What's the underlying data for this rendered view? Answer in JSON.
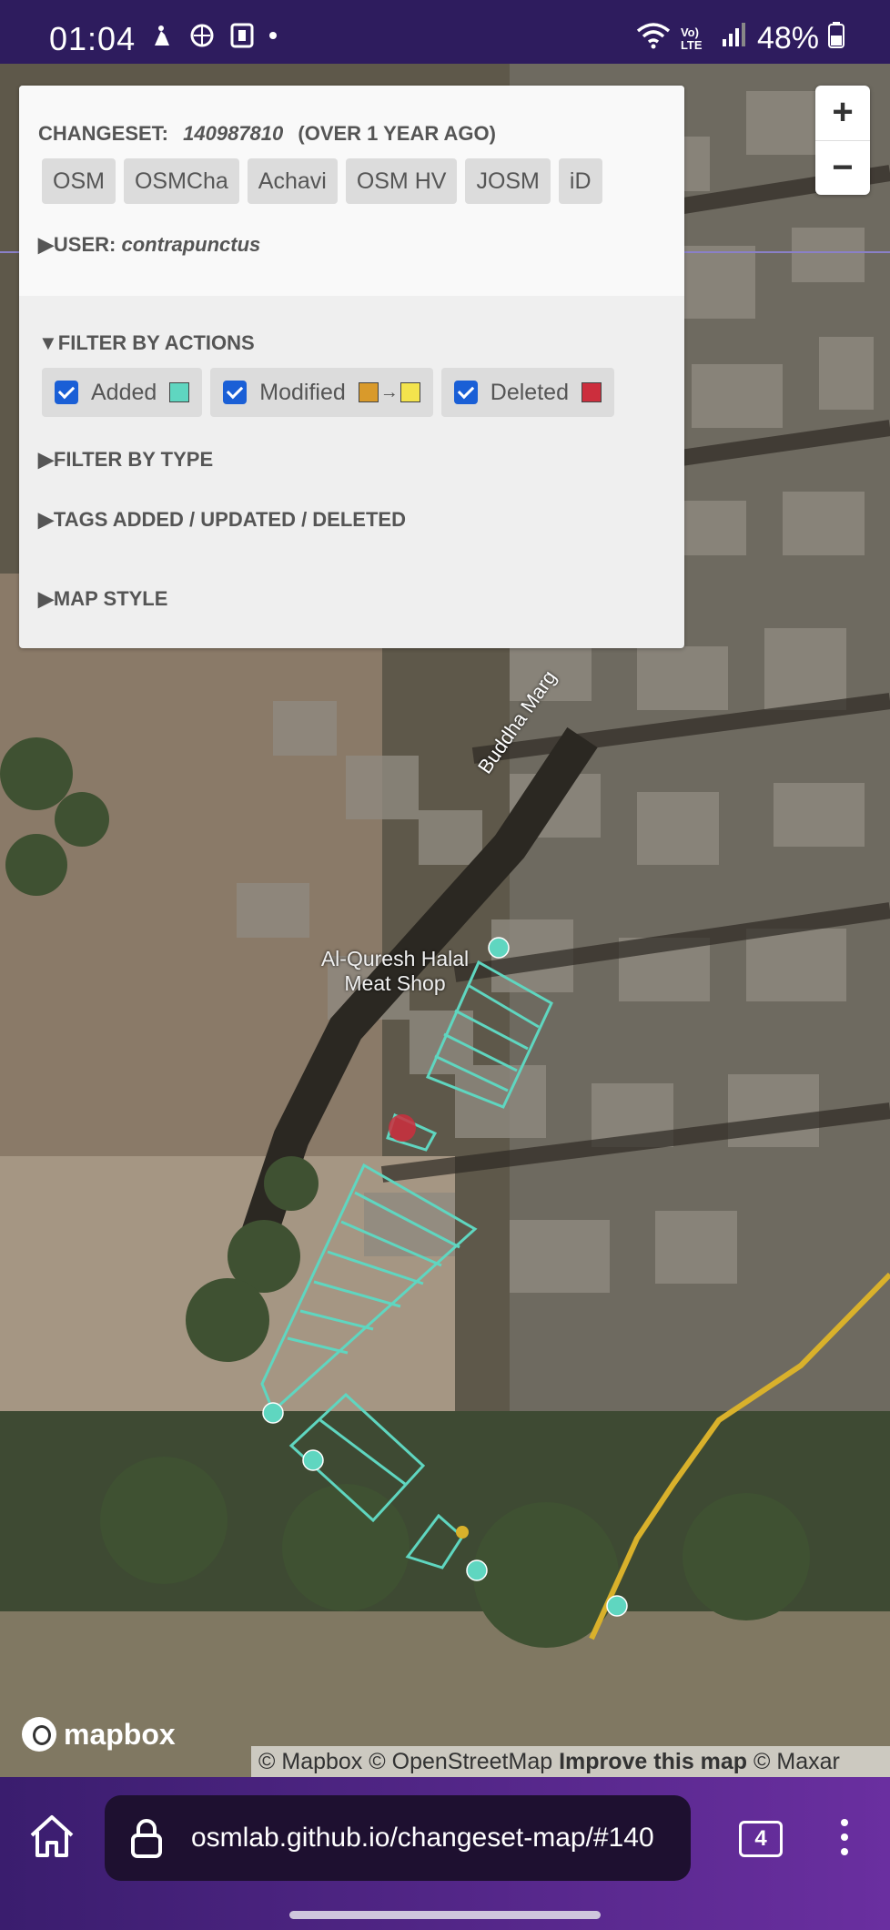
{
  "status_bar": {
    "time": "01:04",
    "battery": "48%",
    "network": "Vo) LTE"
  },
  "changeset_panel": {
    "label": "CHANGESET:",
    "number": "140987810",
    "age": "(OVER 1 YEAR AGO)",
    "links": [
      "OSM",
      "OSMCha",
      "Achavi",
      "OSM HV",
      "JOSM",
      "iD"
    ],
    "user_label": "▶USER:",
    "user_name": "contrapunctus",
    "filter_actions": "▼FILTER BY ACTIONS",
    "actions": [
      {
        "label": "Added",
        "checked": true,
        "color": "#5fd6c0"
      },
      {
        "label": "Modified",
        "checked": true,
        "color_from": "#d99a2b",
        "color_to": "#f3e34d"
      },
      {
        "label": "Deleted",
        "checked": true,
        "color": "#cc2e3d"
      }
    ],
    "arrow": "→",
    "filter_type": "▶FILTER BY TYPE",
    "tags": "▶TAGS ADDED / UPDATED / DELETED",
    "map_style": "▶MAP STYLE"
  },
  "zoom": {
    "plus": "+",
    "minus": "−"
  },
  "map_labels": {
    "road": "Buddha Marg",
    "poi_line1": "Al-Quresh Halal",
    "poi_line2": "Meat Shop"
  },
  "mapbox_logo": "mapbox",
  "attribution": {
    "mapbox": "© Mapbox",
    "osm": "© OpenStreetMap",
    "improve": "Improve this map",
    "maxar": "© Maxar"
  },
  "browser": {
    "url": "osmlab.github.io/changeset-map/#140",
    "tab_count": "4"
  },
  "colors": {
    "added": "#5fd6c0",
    "modified": "#d9b12b",
    "deleted": "#cc2e3d"
  }
}
